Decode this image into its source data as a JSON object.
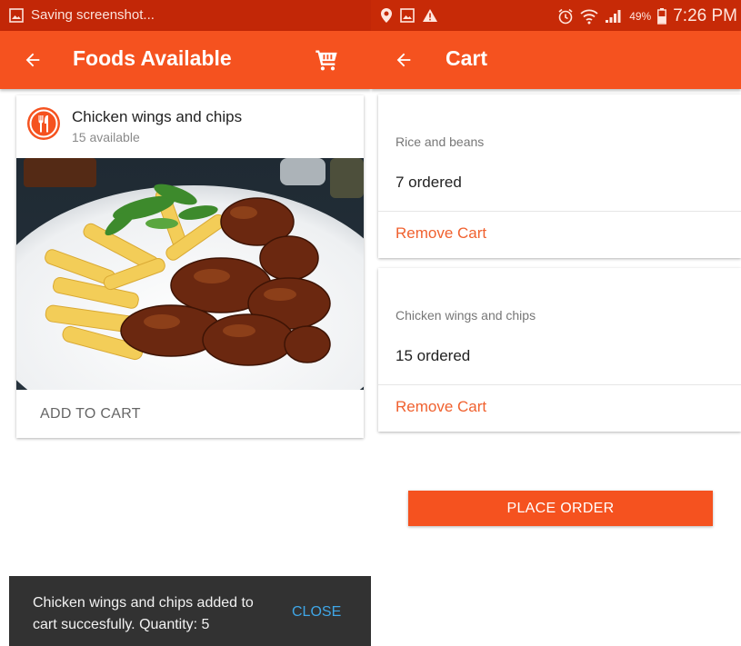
{
  "colors": {
    "accent": "#f5521f",
    "status_bar": "#c62a06",
    "snackbar_bg": "#323232",
    "snackbar_action": "#3fa6e6",
    "remove_link": "#f0612f"
  },
  "left": {
    "status": {
      "text": "Saving screenshot..."
    },
    "appbar": {
      "title": "Foods Available",
      "back_icon": "arrow-left-icon",
      "cart_icon": "cart-icon"
    },
    "food_card": {
      "icon": "restaurant-icon",
      "name": "Chicken wings and chips",
      "availability": "15 available",
      "action": "ADD TO CART"
    },
    "snackbar": {
      "message": "Chicken wings and chips added to cart succesfully. Quantity: 5",
      "action": "CLOSE"
    }
  },
  "right": {
    "status": {
      "battery": "49%",
      "time": "7:26 PM"
    },
    "appbar": {
      "title": "Cart",
      "back_icon": "arrow-left-icon"
    },
    "cart_items": [
      {
        "name": "Rice and beans",
        "quantity": "7 ordered",
        "action": "Remove Cart"
      },
      {
        "name": "Chicken wings and chips",
        "quantity": "15 ordered",
        "action": "Remove Cart"
      }
    ],
    "place_order": "PLACE ORDER"
  }
}
